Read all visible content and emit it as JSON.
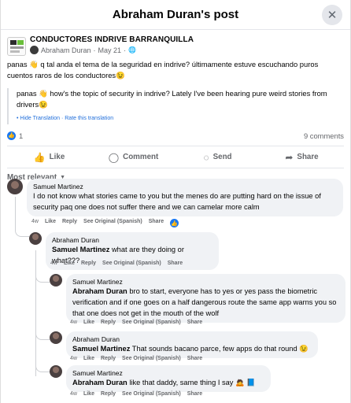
{
  "header": {
    "title": "Abraham Duran's post",
    "close_icon": "close-icon"
  },
  "post": {
    "group_name": "CONDUCTORES INDRIVE BARRANQUILLA",
    "author": "Abraham Duran",
    "date": "May 21",
    "separator": "·",
    "text": "panas 👋 q  tal anda el tema de la seguridad en indrive? últimamente estuve escuchando puros cuentos raros de los conductores😉",
    "translation": "panas 👋 how's the topic of security in indrive? Lately I've been hearing pure weird stories from drivers😉",
    "hide_translation": "Hide Translation",
    "rate_translation": "Rate this translation",
    "dot": "·",
    "like_count": "1",
    "comment_count": "9 comments"
  },
  "actions": {
    "like": "Like",
    "comment": "Comment",
    "send": "Send",
    "share": "Share"
  },
  "sort_label": "Most relevant",
  "comments": [
    {
      "name": "Samuel Martinez",
      "mention": "",
      "text": "I do not know what stories came to you but the menes do are putting hard on the issue of security paq one does not suffer there and we can camelar more calm",
      "time": "4w",
      "like": "Like",
      "reply": "Reply",
      "see_original": "See Original (Spanish)",
      "share": "Share"
    },
    {
      "name": "Abraham Duran",
      "mention": "Samuel Martinez",
      "text": " what are they doing or what???",
      "time": "4w",
      "like": "Like",
      "reply": "Reply",
      "see_original": "See Original (Spanish)",
      "share": "Share"
    },
    {
      "name": "Samuel Martinez",
      "mention": "Abraham Duran",
      "text": " bro to start, everyone has to yes or yes pass the biometric verification and if one goes on a half dangerous route the same app warns you so that one does not get in the mouth of the wolf",
      "time": "4w",
      "like": "Like",
      "reply": "Reply",
      "see_original": "See Original (Spanish)",
      "share": "Share"
    },
    {
      "name": "Abraham Duran",
      "mention": "Samuel Martinez",
      "text": " That sounds bacano parce, few apps do that round 😉",
      "time": "4w",
      "like": "Like",
      "reply": "Reply",
      "see_original": "See Original (Spanish)",
      "share": "Share"
    },
    {
      "name": "Samuel Martinez",
      "mention": "Abraham Duran",
      "text": " like that daddy, same thing I say 🙇 📘",
      "time": "4w",
      "like": "Like",
      "reply": "Reply",
      "see_original": "See Original (Spanish)",
      "share": "Share"
    }
  ]
}
